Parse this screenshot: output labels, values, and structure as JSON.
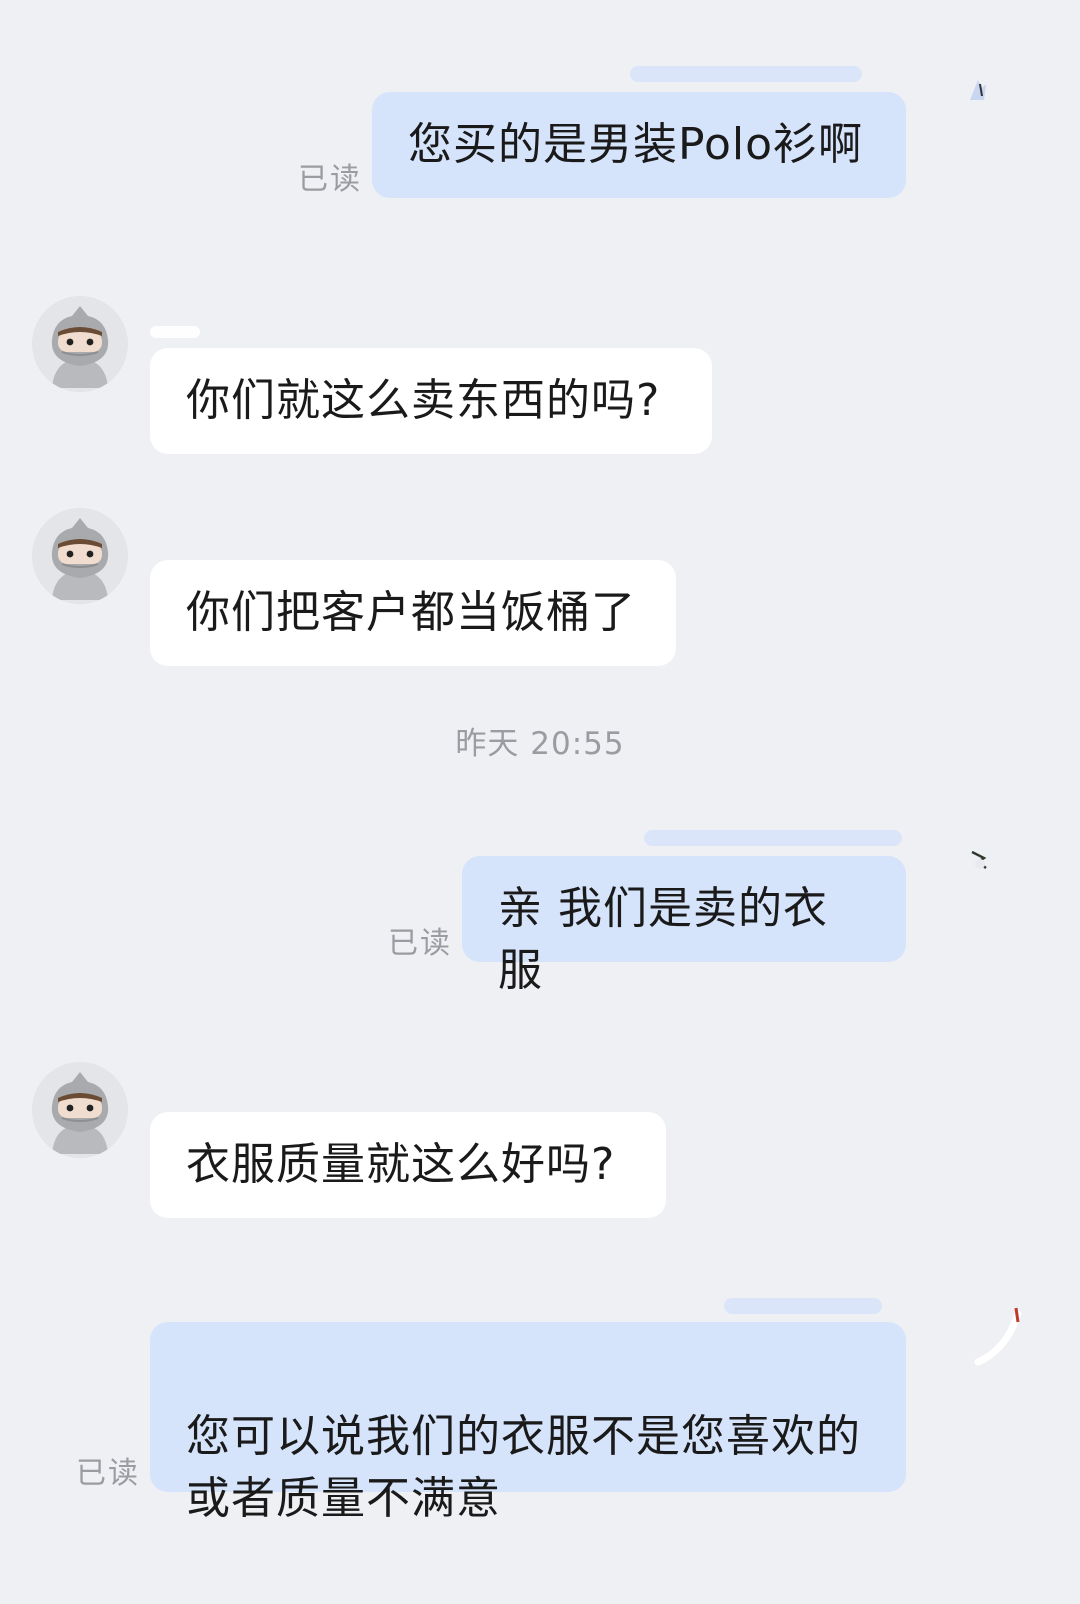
{
  "messages": [
    {
      "direction": "out",
      "text": "您买的是男装Polo衫啊",
      "status": "已读"
    },
    {
      "direction": "in",
      "text": "你们就这么卖东西的吗?"
    },
    {
      "direction": "in",
      "text": "你们把客户都当饭桶了"
    },
    {
      "direction": "out",
      "text": "亲 我们是卖的衣服",
      "status": "已读"
    },
    {
      "direction": "in",
      "text": "衣服质量就这么好吗?"
    },
    {
      "direction": "out",
      "text": "您可以说我们的衣服不是您喜欢的\n或者质量不满意",
      "status": "已读"
    }
  ],
  "timestamp": "昨天 20:55",
  "colors": {
    "background": "#eff0f4",
    "outgoing_bubble": "#d5e3fb",
    "incoming_bubble": "#ffffff",
    "read_status": "#9b9ca1"
  },
  "icons": {
    "avatar": "ninja-avatar-icon"
  }
}
